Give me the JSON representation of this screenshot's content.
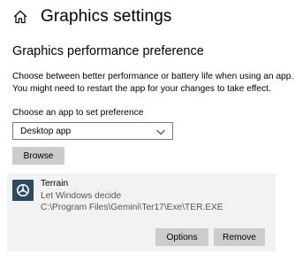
{
  "header": {
    "home_icon": "home-icon",
    "title": "Graphics settings"
  },
  "preference": {
    "section_title": "Graphics performance preference",
    "description_line1": "Choose between better performance or battery life when using an app.",
    "description_line2": "You might need to restart the app for your changes to take effect.",
    "choose_label": "Choose an app to set preference",
    "app_type_selected": "Desktop app",
    "browse_label": "Browse"
  },
  "apps": [
    {
      "name": "Terrain",
      "preference": "Let Windows decide",
      "path": "C:\\Program Files\\Gemini\\Ter17\\Exe\\TER.EXE",
      "icon": "terrain-app-icon",
      "options_label": "Options",
      "remove_label": "Remove"
    }
  ],
  "colors": {
    "button_bg": "#cccccc",
    "card_bg": "#f2f2f2",
    "app_icon_bg": "#2b4a64"
  }
}
